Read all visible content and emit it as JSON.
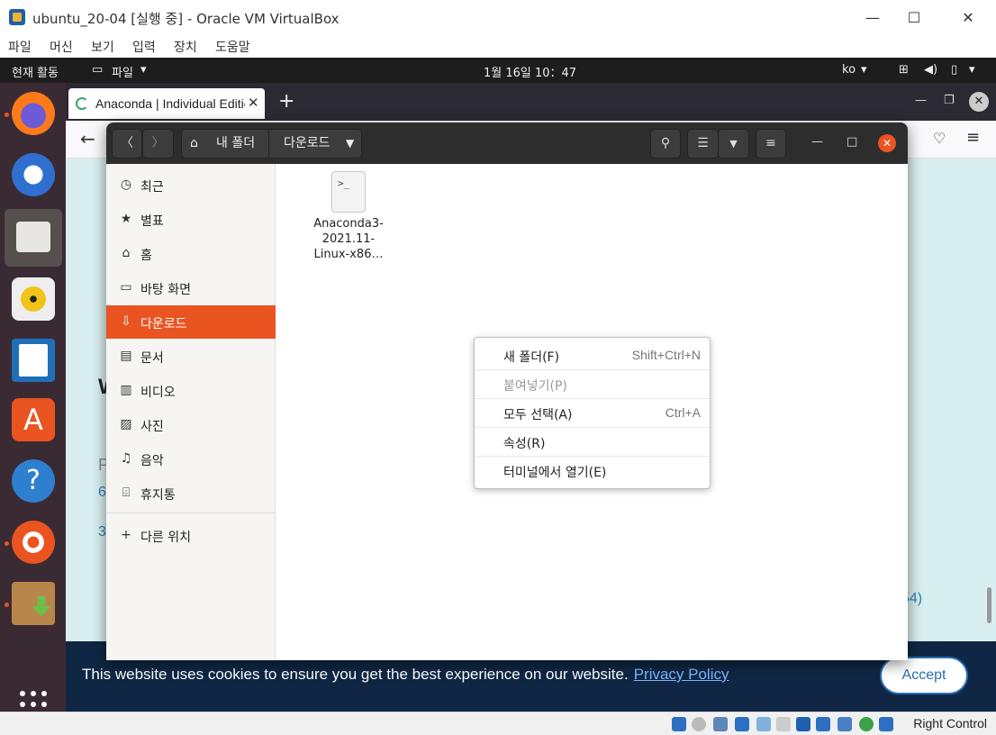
{
  "vbox": {
    "title": "ubuntu_20-04 [실행 중] - Oracle VM VirtualBox",
    "menu": [
      "파일",
      "머신",
      "보기",
      "입력",
      "장치",
      "도움말"
    ],
    "host_key": "Right Control"
  },
  "topbar": {
    "activities": "현재 활동",
    "app_menu": "파일",
    "clock": "1월 16일  10：47",
    "lang": "ko"
  },
  "dock": {
    "apps": [
      "firefox-icon",
      "thunderbird-icon",
      "files-icon",
      "rhythmbox-icon",
      "writer-icon",
      "software-icon",
      "help-icon",
      "ubuntu-icon",
      "installer-icon"
    ]
  },
  "firefox": {
    "tab_title": "Anaconda | Individual Edition",
    "page_fragments": [
      "W",
      "P",
      "6",
      "3",
      "54)"
    ],
    "cookie_text": "This website uses cookies to ensure you get the best experience on our website.",
    "cookie_link": "Privacy Policy",
    "cookie_accept": "Accept"
  },
  "nautilus": {
    "path": [
      "내 폴더",
      "다운로드"
    ],
    "sidebar": [
      {
        "label": "최근",
        "icon": "clock-icon"
      },
      {
        "label": "별표",
        "icon": "star-icon"
      },
      {
        "label": "홈",
        "icon": "home-icon"
      },
      {
        "label": "바탕 화면",
        "icon": "desktop-icon"
      },
      {
        "label": "다운로드",
        "icon": "download-icon"
      },
      {
        "label": "문서",
        "icon": "document-icon"
      },
      {
        "label": "비디오",
        "icon": "video-icon"
      },
      {
        "label": "사진",
        "icon": "picture-icon"
      },
      {
        "label": "음악",
        "icon": "music-icon"
      },
      {
        "label": "휴지통",
        "icon": "trash-icon"
      },
      {
        "label": "다른 위치",
        "icon": "plus-icon"
      }
    ],
    "active_item": "다운로드",
    "files": [
      {
        "name_line1": "Anaconda3-",
        "name_line2": "2021.11-",
        "name_line3": "Linux-x86…",
        "icon_glyph": ">_"
      }
    ]
  },
  "context_menu": {
    "items": [
      {
        "label": "새 폴더(F)",
        "accel": "Shift+Ctrl+N",
        "enabled": true
      },
      {
        "label": "붙여넣기(P)",
        "accel": "",
        "enabled": false
      },
      {
        "label": "모두 선택(A)",
        "accel": "Ctrl+A",
        "enabled": true
      },
      {
        "label": "속성(R)",
        "accel": "",
        "enabled": true
      },
      {
        "label": "터미널에서 열기(E)",
        "accel": "",
        "enabled": true
      }
    ]
  }
}
